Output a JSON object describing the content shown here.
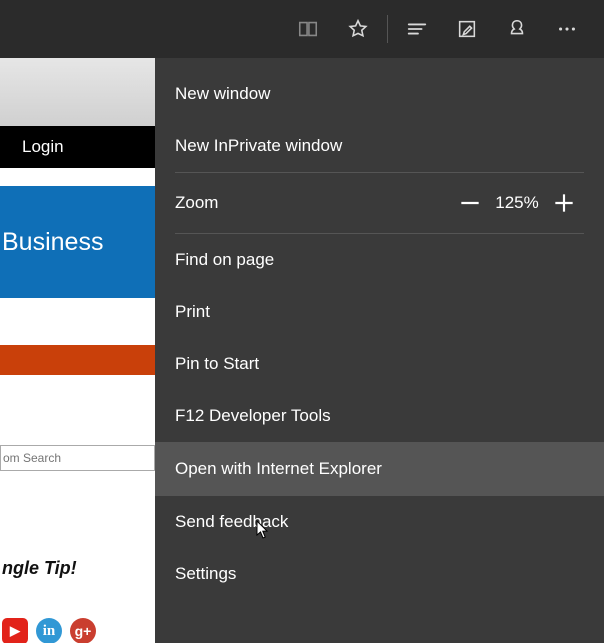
{
  "page": {
    "login": "Login",
    "banner": "Business",
    "search_placeholder": "om Search",
    "tip": "ngle Tip!",
    "social": [
      "▶",
      "in",
      "g+"
    ]
  },
  "menu": {
    "items": [
      "New window",
      "New InPrivate window",
      "Find on page",
      "Print",
      "Pin to Start",
      "F12 Developer Tools",
      "Open with Internet Explorer",
      "Send feedback",
      "Settings"
    ],
    "zoom": {
      "label": "Zoom",
      "value": "125%"
    },
    "highlighted": "Open with Internet Explorer"
  },
  "topbar_icons": [
    "reading-view",
    "favorite-star",
    "hub",
    "web-note",
    "share",
    "more"
  ]
}
